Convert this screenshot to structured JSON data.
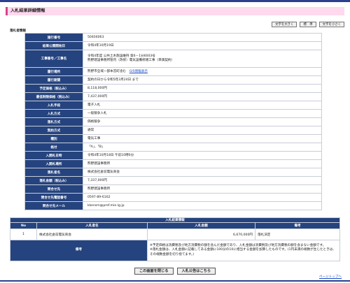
{
  "page": {
    "title": "入札結果詳細情報",
    "section_label": "落札者情報"
  },
  "font_buttons": [
    "文字を大きく",
    "標　準",
    "文字を小さく"
  ],
  "details": [
    {
      "label": "施行番号",
      "value": "50404063"
    },
    {
      "label": "結果公開開始日",
      "value": "令和4年10月19日"
    },
    {
      "label": "工事番号／工事名",
      "value": "令和4年度 公共土木施設維持 第6－1分6003号",
      "value2": "熊野建設事務所管内（改修）電気設備修繕工事（単価契約）"
    },
    {
      "label": "履行場所",
      "value": "熊野市全域一部本宮町含む",
      "link": "GIS情報表示"
    },
    {
      "label": "履行期間",
      "value": "契約の日から令和5年3月24日 まで"
    },
    {
      "label": "予定価格（税込み）",
      "value": "8,118,000円"
    },
    {
      "label": "最低制限価格（税込み）",
      "value": "7,437,000円"
    },
    {
      "label": "入札手段",
      "value": "電子入札"
    },
    {
      "label": "入札方式",
      "value": "一般競争入札"
    },
    {
      "label": "落札方式",
      "value": "価格競争"
    },
    {
      "label": "契約方式",
      "value": "通常"
    },
    {
      "label": "種別",
      "value": "電気工事"
    },
    {
      "label": "格付",
      "value": "「A」、「B」"
    },
    {
      "label": "入開札日時",
      "value": "令和4年10月18日 午前10時0分"
    },
    {
      "label": "入開札場所",
      "value": "熊野建設事務所"
    },
    {
      "label": "落札者名",
      "value": "株式会社倉前電気商会"
    },
    {
      "label": "落札金額（税込み）",
      "value": "7,337,000円"
    },
    {
      "label": "問合せ先",
      "value": "熊野建設事務所"
    },
    {
      "label": "問合せ先電話番号",
      "value": "0597-89-6162"
    },
    {
      "label": "問合せ先メール",
      "value": "kkensm@pref.mie.lg.jp"
    }
  ],
  "results": {
    "caption": "入札結果情報",
    "headers": [
      "No",
      "入札者名",
      "入札金額",
      "備考"
    ],
    "rows": [
      {
        "no": "1",
        "name": "株式会社倉前電気商会",
        "amount": "6,670,000円",
        "note": "落札決定"
      }
    ],
    "remarks_label": "備考",
    "remarks": [
      "※予定価格は消費税及び地方消費税の額を含んだ金額であり、入札金額は消費税及び地方消費税の額を含まない金額です。",
      "※落札金額は、入札金額に記載してある金額に100分の10に相当する金額を加算したものです。(1円未満の端数が生じたときは、その端数金額を切り捨てます。)"
    ]
  },
  "buttons": {
    "close": "この画面を閉じる",
    "notice": "入札公告はこちら"
  },
  "pagetop": "ページトップへ"
}
